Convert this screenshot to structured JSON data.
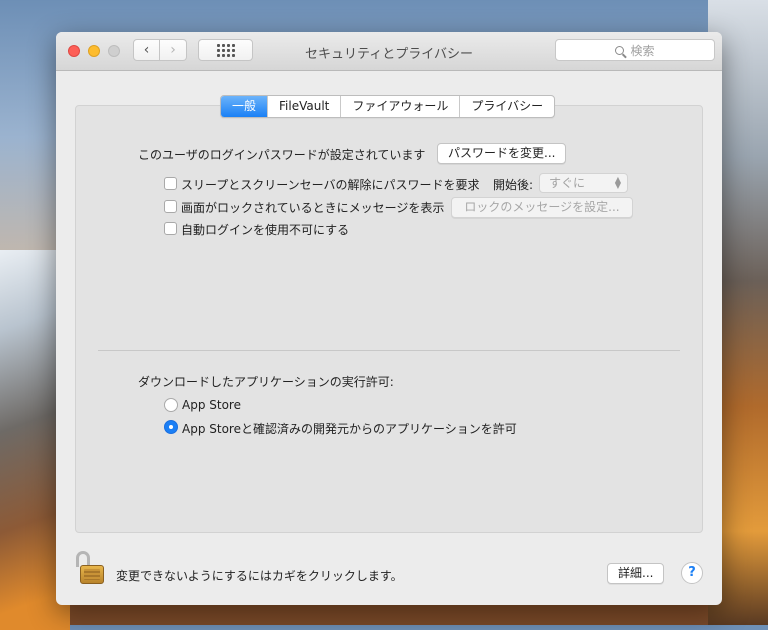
{
  "window": {
    "title": "セキュリティとプライバシー",
    "search_placeholder": "検索"
  },
  "tabs": [
    {
      "label": "一般",
      "active": true
    },
    {
      "label": "FileVault",
      "active": false
    },
    {
      "label": "ファイアウォール",
      "active": false
    },
    {
      "label": "プライバシー",
      "active": false
    }
  ],
  "general": {
    "password_label": "このユーザのログインパスワードが設定されています",
    "change_password_button": "パスワードを変更...",
    "require_password_label": "スリープとスクリーンセーバの解除にパスワードを要求",
    "start_after_label": "開始後:",
    "start_after_value": "すぐに",
    "show_message_label": "画面がロックされているときにメッセージを表示",
    "set_lock_message_button": "ロックのメッセージを設定...",
    "disable_autologin_label": "自動ログインを使用不可にする"
  },
  "downloads": {
    "heading": "ダウンロードしたアプリケーションの実行許可:",
    "option_app_store": "App Store",
    "option_app_store_identified": "App Storeと確認済みの開発元からのアプリケーションを許可",
    "selected": "option_app_store_identified"
  },
  "footer": {
    "lock_text": "変更できないようにするにはカギをクリックします。",
    "advanced_button": "詳細...",
    "help_glyph": "?"
  },
  "colors": {
    "accent": "#1b7ff5",
    "close": "#fd5f57",
    "minimize": "#fdbc2e"
  }
}
